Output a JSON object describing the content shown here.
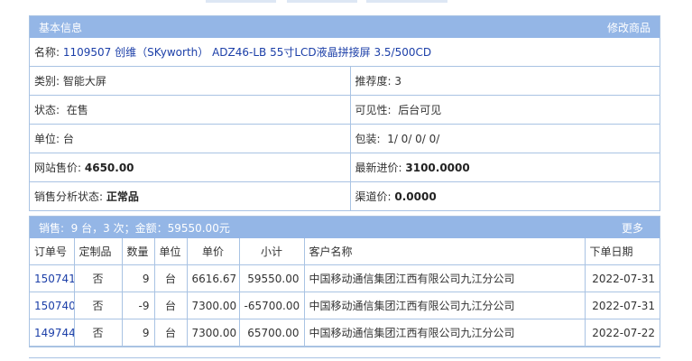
{
  "basic": {
    "title": "基本信息",
    "edit_label": "修改商品",
    "name_label": "名称:",
    "name_value": "1109507 创维（SKyworth） ADZ46-LB 55寸LCD液晶拼接屏 3.5/500CD",
    "category_label": "类别:",
    "category_value": "智能大屏",
    "recommend_label": "推荐度:",
    "recommend_value": "3",
    "status_label": "状态:",
    "status_value": "在售",
    "visibility_label": "可见性:",
    "visibility_value": "后台可见",
    "unit_label": "单位:",
    "unit_value": "台",
    "package_label": "包装:",
    "package_value": "1/ 0/ 0/ 0/",
    "web_price_label": "网站售价:",
    "web_price_value": "4650.00",
    "latest_cost_label": "最新进价:",
    "latest_cost_value": "3100.0000",
    "sales_status_label": "销售分析状态:",
    "sales_status_value": "正常品",
    "channel_price_label": "渠道价:",
    "channel_price_value": "0.0000"
  },
  "sales": {
    "summary": "销售:  9 台，3 次；金额：59550.00元",
    "more_label": "更多",
    "columns": [
      "订单号",
      "定制品",
      "数量",
      "单位",
      "单价",
      "小计",
      "客户名称",
      "下单日期"
    ],
    "rows": [
      {
        "order": "150741",
        "custom": "否",
        "qty": "9",
        "unit": "台",
        "price": "6616.67",
        "subtotal": "59550.00",
        "customer": "中国移动通信集团江西有限公司九江分公司",
        "date": "2022-07-31"
      },
      {
        "order": "150740",
        "custom": "否",
        "qty": "-9",
        "unit": "台",
        "price": "7300.00",
        "subtotal": "-65700.00",
        "customer": "中国移动通信集团江西有限公司九江分公司",
        "date": "2022-07-31"
      },
      {
        "order": "149744",
        "custom": "否",
        "qty": "9",
        "unit": "台",
        "price": "7300.00",
        "subtotal": "65700.00",
        "customer": "中国移动通信集团江西有限公司九江分公司",
        "date": "2022-07-22"
      }
    ]
  }
}
